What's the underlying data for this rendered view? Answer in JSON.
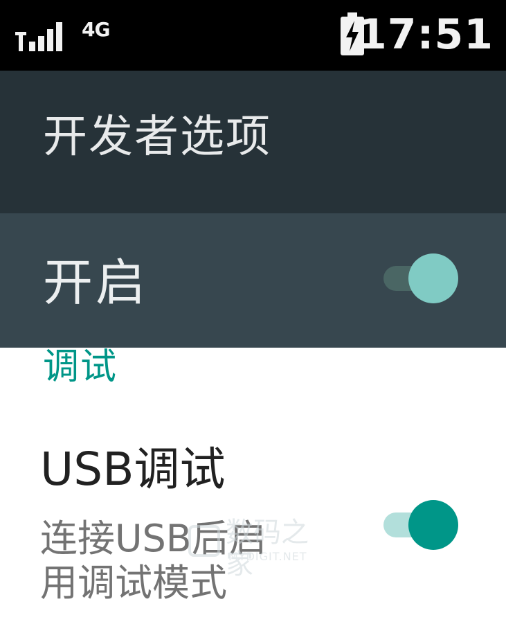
{
  "status_bar": {
    "network_type": "4G",
    "time": "17:51",
    "signal_icon": "signal-bars-icon",
    "battery_icon": "battery-charging-icon"
  },
  "app_bar": {
    "title": "开发者选项"
  },
  "master_switch": {
    "label": "开启",
    "checked": true
  },
  "sections": {
    "debug": {
      "header": "调试",
      "usb_debugging": {
        "title": "USB调试",
        "summary_line1": "连接USB后启",
        "summary_line2": "用调试模式",
        "checked": true
      }
    }
  },
  "watermark": {
    "text_cn": "数码之家",
    "text_en": "MYDIGIT.NET"
  },
  "colors": {
    "status_bar": "#000000",
    "app_bar": "#263238",
    "master_bar": "#37474f",
    "accent": "#009688",
    "accent_light": "#80cbc4"
  }
}
